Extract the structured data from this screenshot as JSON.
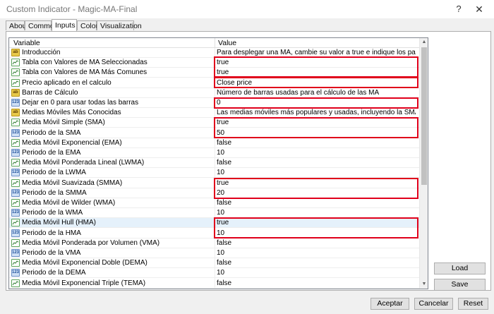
{
  "window": {
    "title": "Custom Indicator - Magic-MA-Final",
    "help": "?",
    "close": "✕"
  },
  "tabs": [
    "About",
    "Common",
    "Inputs",
    "Colors",
    "Visualization"
  ],
  "active_tab": "Inputs",
  "columns": {
    "variable": "Variable",
    "value": "Value"
  },
  "rows": [
    {
      "icon": "ab",
      "name": "Introducción",
      "value": "Para desplegar una MA, cambie su valor a true e indique los parámetros de su elec..."
    },
    {
      "icon": "ma",
      "name": "Tabla con Valores de MA Seleccionadas",
      "value": "true"
    },
    {
      "icon": "ma",
      "name": "Tabla con Valores de MA Más Comunes",
      "value": "true"
    },
    {
      "icon": "ma",
      "name": "Precio aplicado en el calculo",
      "value": "Close price"
    },
    {
      "icon": "ab",
      "name": "Barras de Cálculo",
      "value": "Número de barras usadas para el cálculo de las MA"
    },
    {
      "icon": "num",
      "name": "Dejar en 0 para usar todas las barras",
      "value": "0"
    },
    {
      "icon": "ab",
      "name": "Medias Móviles Más Conocidas",
      "value": "Las medias móviles más populares y usadas, incluyendo la SMA,EMA,SMMA,DEM..."
    },
    {
      "icon": "ma",
      "name": "Media Móvil Simple (SMA)",
      "value": "true"
    },
    {
      "icon": "num",
      "name": "Periodo de la SMA",
      "value": "50"
    },
    {
      "icon": "ma",
      "name": "Media Móvil Exponencial (EMA)",
      "value": "false"
    },
    {
      "icon": "num",
      "name": "Periodo de la EMA",
      "value": "10"
    },
    {
      "icon": "ma",
      "name": "Media Móvil Ponderada Lineal (LWMA)",
      "value": "false"
    },
    {
      "icon": "num",
      "name": "Periodo de la LWMA",
      "value": "10"
    },
    {
      "icon": "ma",
      "name": "Media Móvil Suavizada (SMMA)",
      "value": "true"
    },
    {
      "icon": "num",
      "name": "Periodo de la SMMA",
      "value": "20"
    },
    {
      "icon": "ma",
      "name": "Media Móvil de Wilder (WMA)",
      "value": "false"
    },
    {
      "icon": "num",
      "name": "Periodo de la WMA",
      "value": "10"
    },
    {
      "icon": "ma",
      "name": "Media Móvil Hull (HMA)",
      "value": "true"
    },
    {
      "icon": "num",
      "name": "Periodo de la HMA",
      "value": "10"
    },
    {
      "icon": "ma",
      "name": "Media Móvil Ponderada por Volumen (VMA)",
      "value": "false"
    },
    {
      "icon": "num",
      "name": "Periodo de la VMA",
      "value": "10"
    },
    {
      "icon": "ma",
      "name": "Media Móvil Exponencial Doble (DEMA)",
      "value": "false"
    },
    {
      "icon": "num",
      "name": "Periodo de la DEMA",
      "value": "10"
    },
    {
      "icon": "ma",
      "name": "Media Móvil Exponencial Triple (TEMA)",
      "value": "false"
    }
  ],
  "icon_labels": {
    "ab": "ab",
    "num": "123"
  },
  "buttons": {
    "load": "Load",
    "save": "Save",
    "accept": "Aceptar",
    "cancel": "Cancelar",
    "reset": "Reset"
  },
  "colors": {
    "highlight": "#e0001b",
    "selection": "#e5f1fb"
  },
  "selected_row": 17
}
